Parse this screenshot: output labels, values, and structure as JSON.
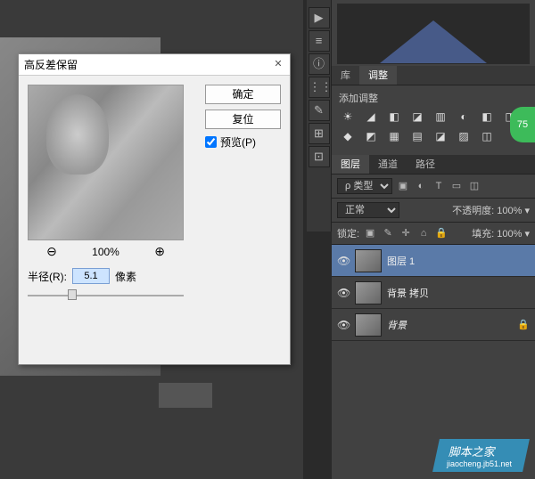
{
  "dialog": {
    "title": "高反差保留",
    "ok": "确定",
    "reset": "复位",
    "preview_label": "预览(P)",
    "zoom_percent": "100%",
    "radius_label": "半径(R):",
    "radius_value": "5.1",
    "radius_unit": "像素"
  },
  "tool_icons": [
    "▶",
    "≡",
    "ⓘ",
    "⋮⋮",
    "✎",
    "⊞",
    "⊡"
  ],
  "right": {
    "tab_lib": "库",
    "tab_adj": "调整",
    "add_adj": "添加调整",
    "adj_icons": [
      "☀",
      "◢",
      "◧",
      "◪",
      "▥",
      "◐",
      "◧",
      "◨",
      "◆",
      "◩",
      "▦",
      "▤",
      "◪",
      "▨",
      "◫"
    ],
    "circle_badge": "75"
  },
  "layer_panel": {
    "tab_layer": "图层",
    "tab_channel": "通道",
    "tab_path": "路径",
    "kind_label": "ρ 类型",
    "kind_icons": [
      "▣",
      "◐",
      "T",
      "▭",
      "◫"
    ],
    "blend_mode": "正常",
    "opacity_label": "不透明度:",
    "opacity_value": "100%",
    "lock_label": "锁定:",
    "lock_icons": [
      "▣",
      "✎",
      "✛",
      "⌂",
      "🔒"
    ],
    "fill_label": "填充:",
    "fill_value": "100%",
    "layers": [
      {
        "name": "图层 1",
        "selected": true,
        "locked": false
      },
      {
        "name": "背景 拷贝",
        "selected": false,
        "locked": false
      },
      {
        "name": "背景",
        "selected": false,
        "locked": true
      }
    ]
  },
  "watermark": {
    "main": "脚本之家",
    "sub": "jiaocheng.jb51.net"
  }
}
